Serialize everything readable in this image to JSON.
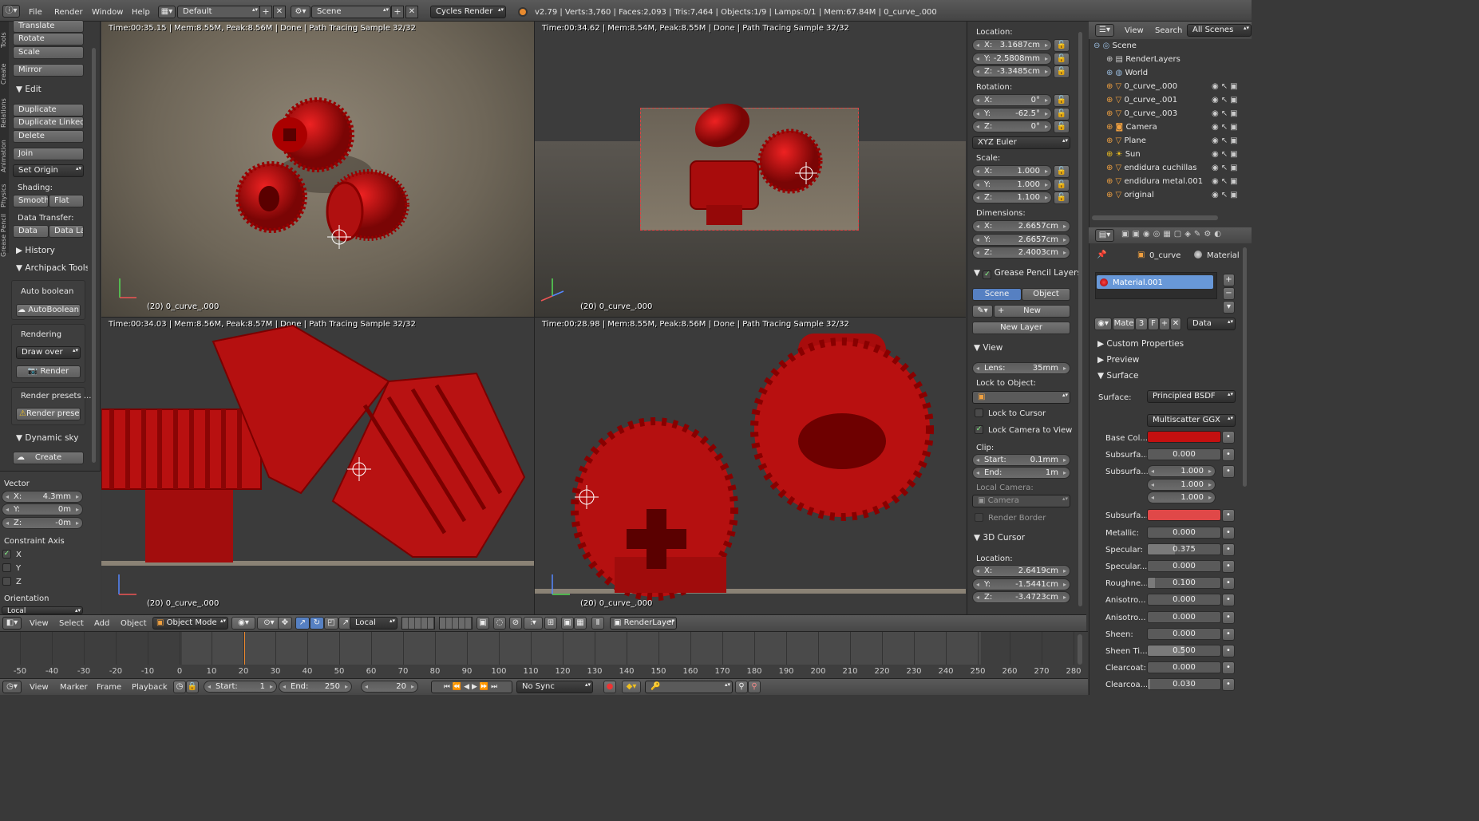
{
  "topbar": {
    "menus": [
      "File",
      "Render",
      "Window",
      "Help"
    ],
    "layout": "Default",
    "scene": "Scene",
    "engine": "Cycles Render",
    "stats": "v2.79 | Verts:3,760 | Faces:2,093 | Tris:7,464 | Objects:1/9 | Lamps:0/1 | Mem:67.84M | 0_curve_.000"
  },
  "tools": {
    "vtabs": [
      "Tools",
      "Create",
      "Relations",
      "Animation",
      "Physics",
      "Grease Pencil"
    ],
    "translate": "Translate",
    "rotate": "Rotate",
    "scale": "Scale",
    "mirror": "Mirror",
    "edit_header": "Edit",
    "duplicate": "Duplicate",
    "duplicate_linked": "Duplicate Linked",
    "delete": "Delete",
    "join": "Join",
    "set_origin": "Set Origin",
    "shading_label": "Shading:",
    "smooth": "Smooth",
    "flat": "Flat",
    "data_transfer_label": "Data Transfer:",
    "data": "Data",
    "data_la": "Data La",
    "history": "History",
    "archipack": "Archipack Tools",
    "auto_boolean_label": "Auto boolean",
    "auto_boolean_btn": "AutoBoolean",
    "rendering_label": "Rendering",
    "draw_over": "Draw over",
    "render_btn": "Render",
    "render_presets_label": "Render presets ...",
    "render_presets_btn": "Render prese...",
    "dynamic_sky": "Dynamic sky",
    "create": "Create"
  },
  "operator": {
    "vector_label": "Vector",
    "x": "X:",
    "x_val": "4.3mm",
    "y": "Y:",
    "y_val": "0m",
    "z": "Z:",
    "z_val": "-0m",
    "constraint_label": "Constraint Axis",
    "cx": "X",
    "cy": "Y",
    "cz": "Z",
    "cx_checked": true,
    "cy_checked": false,
    "cz_checked": false,
    "orientation_label": "Orientation",
    "orientation_val": "Local"
  },
  "viewports": [
    {
      "info": "Time:00:35.15 | Mem:8.55M, Peak:8.56M | Done | Path Tracing Sample 32/32",
      "name": "(20) 0_curve_.000"
    },
    {
      "info": "Time:00:34.62 | Mem:8.54M, Peak:8.55M | Done | Path Tracing Sample 32/32",
      "name": "(20) 0_curve_.000"
    },
    {
      "info": "Time:00:34.03 | Mem:8.56M, Peak:8.57M | Done | Path Tracing Sample 32/32",
      "name": "(20) 0_curve_.000"
    },
    {
      "info": "Time:00:28.98 | Mem:8.55M, Peak:8.56M | Done | Path Tracing Sample 32/32",
      "name": "(20) 0_curve_.000"
    }
  ],
  "nprops": {
    "location_label": "Location:",
    "loc": [
      {
        "a": "X:",
        "v": "3.1687cm"
      },
      {
        "a": "Y:",
        "v": "-2.5808mm"
      },
      {
        "a": "Z:",
        "v": "-3.3485cm"
      }
    ],
    "rotation_label": "Rotation:",
    "rot": [
      {
        "a": "X:",
        "v": "0°"
      },
      {
        "a": "Y:",
        "v": "-62.5°"
      },
      {
        "a": "Z:",
        "v": "0°"
      }
    ],
    "rot_mode": "XYZ Euler",
    "scale_label": "Scale:",
    "scl": [
      {
        "a": "X:",
        "v": "1.000"
      },
      {
        "a": "Y:",
        "v": "1.000"
      },
      {
        "a": "Z:",
        "v": "1.100"
      }
    ],
    "dimensions_label": "Dimensions:",
    "dim": [
      {
        "a": "X:",
        "v": "2.6657cm"
      },
      {
        "a": "Y:",
        "v": "2.6657cm"
      },
      {
        "a": "Z:",
        "v": "2.4003cm"
      }
    ],
    "gp_header": "Grease Pencil Layers",
    "gp_scene": "Scene",
    "gp_object": "Object",
    "gp_new": "New",
    "gp_new_layer": "New Layer",
    "view_header": "View",
    "lens_label": "Lens:",
    "lens_val": "35mm",
    "lock_object_label": "Lock to Object:",
    "lock_cursor": "Lock to Cursor",
    "lock_camera": "Lock Camera to View",
    "clip_label": "Clip:",
    "clip_start_label": "Start:",
    "clip_start": "0.1mm",
    "clip_end_label": "End:",
    "clip_end": "1m",
    "local_camera_label": "Local Camera:",
    "local_camera": "Camera",
    "render_border": "Render Border",
    "cursor_header": "3D Cursor",
    "cursor_location_label": "Location:",
    "cur": [
      {
        "a": "X:",
        "v": "2.6419cm"
      },
      {
        "a": "Y:",
        "v": "-1.5441cm"
      },
      {
        "a": "Z:",
        "v": "-3.4723cm"
      }
    ]
  },
  "outliner": {
    "view": "View",
    "search": "Search",
    "all_scenes": "All Scenes",
    "items": [
      "Scene",
      "RenderLayers",
      "World",
      "0_curve_.000",
      "0_curve_.001",
      "0_curve_.003",
      "Camera",
      "Plane",
      "Sun",
      "endidura cuchillas",
      "endidura metal.001",
      "original"
    ]
  },
  "material": {
    "breadcrumb_obj": "0_curve",
    "breadcrumb_mat": "Material",
    "slot": "Material.001",
    "mat_short": "Mate",
    "users": "3",
    "fake": "F",
    "data_dd": "Data",
    "custom_props": "Custom Properties",
    "preview": "Preview",
    "surface": "Surface",
    "surface_label": "Surface:",
    "surface_val": "Principled BSDF",
    "distribution": "Multiscatter GGX",
    "base_color_label": "Base Col...",
    "base_color": "#c41010",
    "subsurface_label": "Subsurfa...",
    "subsurface_val": "0.000",
    "subsurface_radius_label": "Subsurfa...",
    "radius": [
      "1.000",
      "1.000",
      "1.000"
    ],
    "subsurface_color_label": "Subsurfa...",
    "subsurface_color": "#e04848",
    "rows": [
      {
        "label": "Metallic:",
        "val": "0.000",
        "fill": 0.0
      },
      {
        "label": "Specular:",
        "val": "0.375",
        "fill": 0.375
      },
      {
        "label": "Specular...",
        "val": "0.000",
        "fill": 0.0
      },
      {
        "label": "Roughne...",
        "val": "0.100",
        "fill": 0.1
      },
      {
        "label": "Anisotro...",
        "val": "0.000",
        "fill": 0.0
      },
      {
        "label": "Anisotro...",
        "val": "0.000",
        "fill": 0.0
      },
      {
        "label": "Sheen:",
        "val": "0.000",
        "fill": 0.0
      },
      {
        "label": "Sheen Ti...",
        "val": "0.500",
        "fill": 0.5
      },
      {
        "label": "Clearcoat:",
        "val": "0.000",
        "fill": 0.0
      },
      {
        "label": "Clearcoa...",
        "val": "0.030",
        "fill": 0.03
      }
    ]
  },
  "view3d_header": {
    "menus": [
      "View",
      "Select",
      "Add",
      "Object"
    ],
    "mode": "Object Mode",
    "orientation": "Local",
    "render_layer": "RenderLayer"
  },
  "timeline": {
    "ticks": [
      "-50",
      "-40",
      "-30",
      "-20",
      "-10",
      "0",
      "10",
      "20",
      "30",
      "40",
      "50",
      "60",
      "70",
      "80",
      "90",
      "100",
      "110",
      "120",
      "130",
      "140",
      "150",
      "160",
      "170",
      "180",
      "190",
      "200",
      "210",
      "220",
      "230",
      "240",
      "250",
      "260",
      "270",
      "280"
    ],
    "menus": [
      "View",
      "Marker",
      "Frame",
      "Playback"
    ],
    "start_label": "Start:",
    "start": "1",
    "end_label": "End:",
    "end": "250",
    "current": "20",
    "sync": "No Sync"
  },
  "colors": {
    "accent_blue": "#5680c2",
    "gear_red": "#b01010",
    "timeline_cursor": "#f08a2e"
  }
}
